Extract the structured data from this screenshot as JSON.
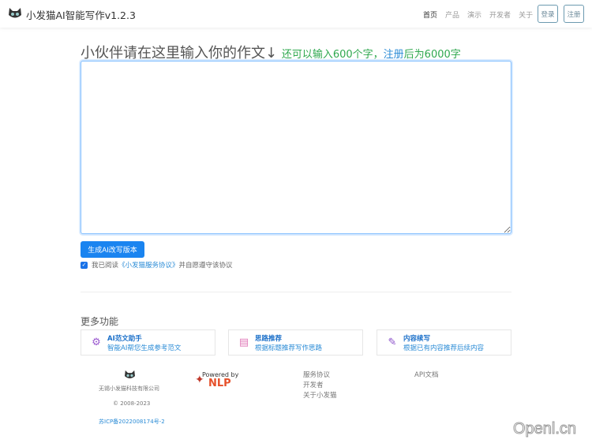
{
  "nav": {
    "title": "小发猫AI智能写作v1.2.3",
    "links": [
      "首页",
      "产品",
      "演示",
      "开发者",
      "关于"
    ],
    "login": "登录",
    "register": "注册"
  },
  "main": {
    "heading": "小伙伴请在这里输入你的作文↓",
    "remain": "还可以输入600个字，",
    "register_link": "注册",
    "after": "后为6000字",
    "textarea_value": "",
    "generate": "生成AI改写版本",
    "agree_pre": "我已阅读",
    "agree_link": "《小发猫服务协议》",
    "agree_post": "并自愿遵守该协议"
  },
  "more": {
    "title": "更多功能",
    "cards": [
      {
        "title": "AI范文助手",
        "desc": "智能AI帮您生成参考范文"
      },
      {
        "title": "思路推荐",
        "desc": "根据标题推荐写作思路"
      },
      {
        "title": "内容续写",
        "desc": "根据已有内容推荐后续内容"
      }
    ]
  },
  "footer": {
    "company": "无锡小发猫科技有限公司",
    "copyright": "© 2008-2023",
    "icp": "苏ICP备2022008174号-2",
    "powered": "Powered by",
    "nlp": "NLP",
    "links": [
      "服务协议",
      "开发者",
      "关于小发猫"
    ],
    "api": "API文档"
  },
  "watermark": "Openl.cn"
}
